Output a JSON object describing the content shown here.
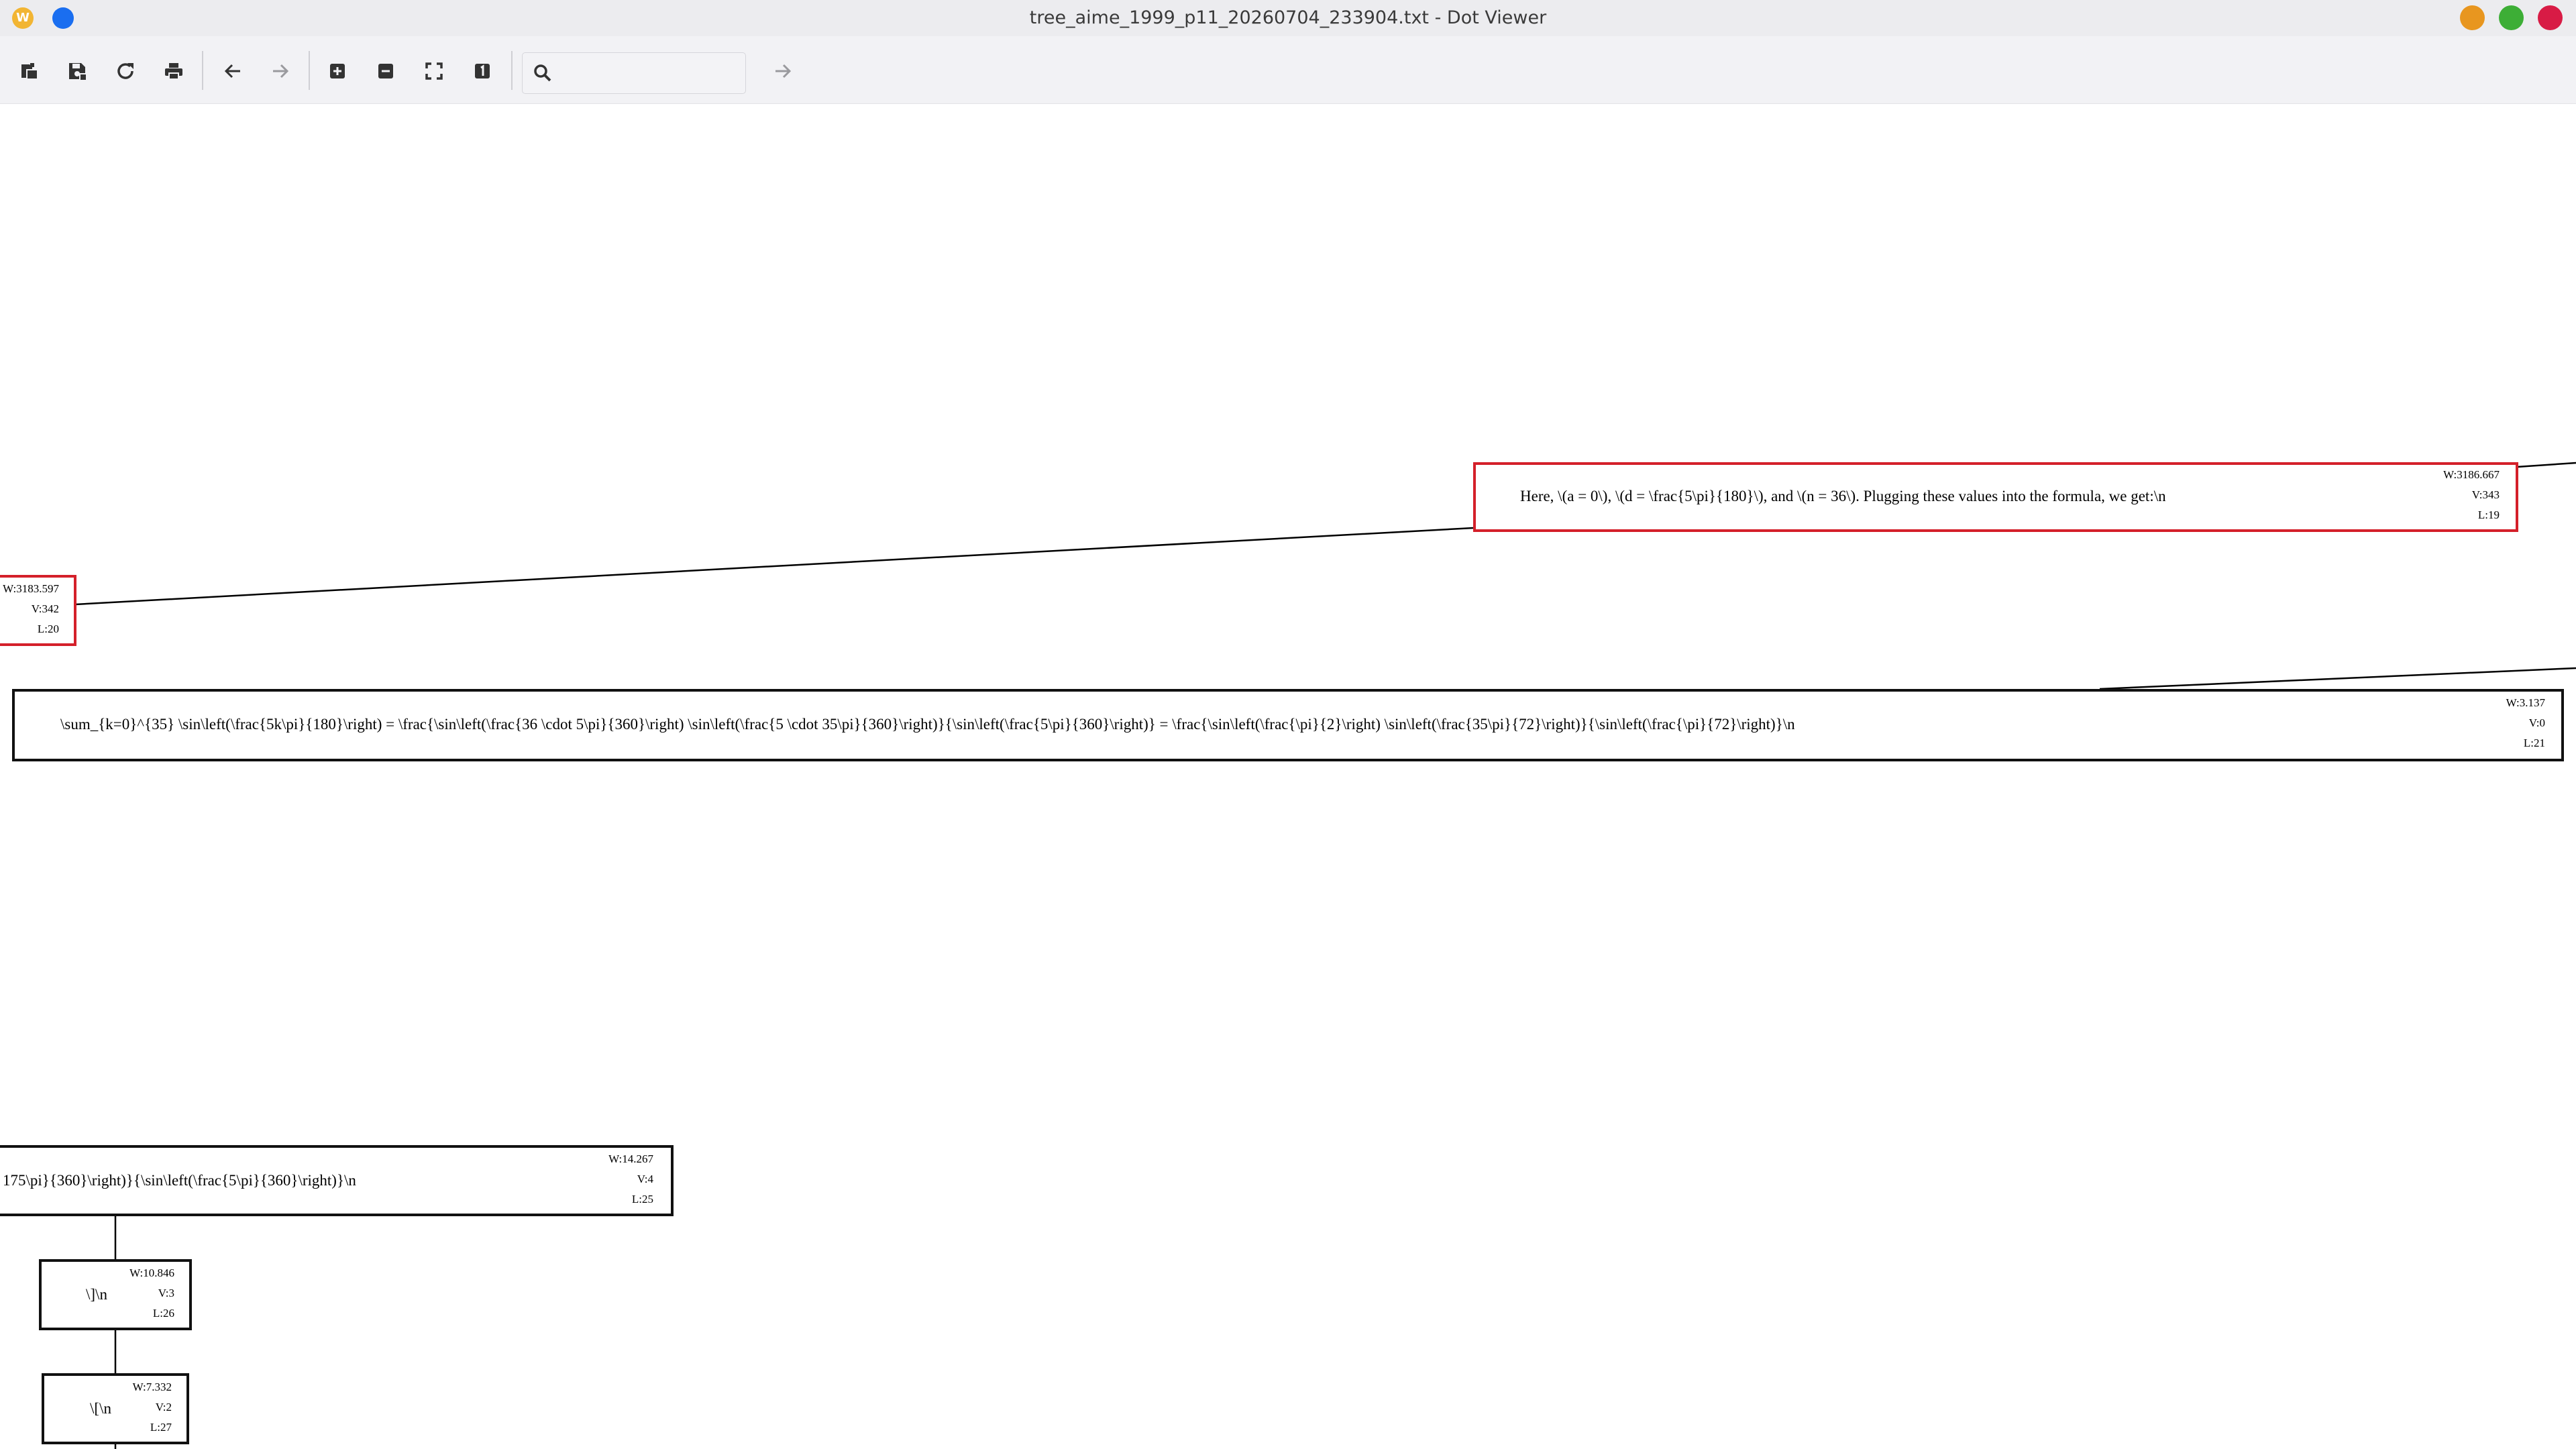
{
  "window": {
    "title": "tree_aime_1999_p11_20260704_233904.txt - Dot Viewer",
    "app_icon_letter": "W",
    "controls_colors": {
      "minimize": "#e8961f",
      "maximize": "#3dae36",
      "close": "#d81b45"
    }
  },
  "toolbar": {
    "search": {
      "value": "",
      "placeholder": ""
    }
  },
  "graph": {
    "nodes": [
      {
        "id": "n343",
        "style": "red",
        "label": "Here, \\(a = 0\\), \\(d = \\frac{5\\pi}{180}\\), and \\(n = 36\\). Plugging these values into the formula, we get:\\n",
        "w": "W:3186.667",
        "v": "V:343",
        "l": "L:19"
      },
      {
        "id": "n342",
        "style": "red",
        "label": "",
        "w": "W:3183.597",
        "v": "V:342",
        "l": "L:20"
      },
      {
        "id": "n0",
        "style": "black",
        "label": "\\sum_{k=0}^{35} \\sin\\left(\\frac{5k\\pi}{180}\\right) = \\frac{\\sin\\left(\\frac{36 \\cdot 5\\pi}{360}\\right) \\sin\\left(\\frac{5 \\cdot 35\\pi}{360}\\right)}{\\sin\\left(\\frac{5\\pi}{360}\\right)} = \\frac{\\sin\\left(\\frac{\\pi}{2}\\right) \\sin\\left(\\frac{35\\pi}{72}\\right)}{\\sin\\left(\\frac{\\pi}{72}\\right)}\\n",
        "w": "W:3.137",
        "v": "V:0",
        "l": "L:21"
      },
      {
        "id": "n4",
        "style": "black",
        "label": "175\\pi}{360}\\right)}{\\sin\\left(\\frac{5\\pi}{360}\\right)}\\n",
        "w": "W:14.267",
        "v": "V:4",
        "l": "L:25"
      },
      {
        "id": "n3",
        "style": "black",
        "label": "\\]\\n",
        "w": "W:10.846",
        "v": "V:3",
        "l": "L:26"
      },
      {
        "id": "n2",
        "style": "black",
        "label": "\\[\\n",
        "w": "W:7.332",
        "v": "V:2",
        "l": "L:27"
      }
    ]
  }
}
